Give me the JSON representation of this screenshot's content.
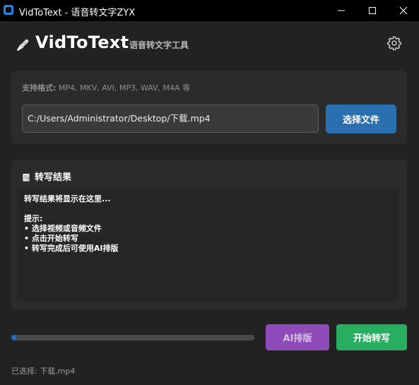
{
  "window": {
    "title": "VidToText - 语音转文字ZYX"
  },
  "header": {
    "app_title": "VidToText",
    "subtitle": "语音转文字工具"
  },
  "file_panel": {
    "formats_label": "支持格式:",
    "formats_value": " MP4, MKV, AVI, MP3, WAV, M4A 等",
    "path_value": "C:/Users/Administrator/Desktop/下载.mp4",
    "choose_button": "选择文件"
  },
  "result_panel": {
    "title": "转写结果",
    "lines": [
      "转写结果将显示在这里...",
      "",
      "提示:",
      "• 选择视频或音频文件",
      "• 点击开始转写",
      "• 转写完成后可使用AI排版"
    ]
  },
  "progress": {
    "value": 0.02
  },
  "buttons": {
    "ai_format": "AI排版",
    "start": "开始转写"
  },
  "status": {
    "text": "已选择: 下载.mp4"
  },
  "colors": {
    "accent_blue": "#2a6fb0",
    "ai_purple": "#8e4ab8",
    "start_green": "#27ae60"
  }
}
